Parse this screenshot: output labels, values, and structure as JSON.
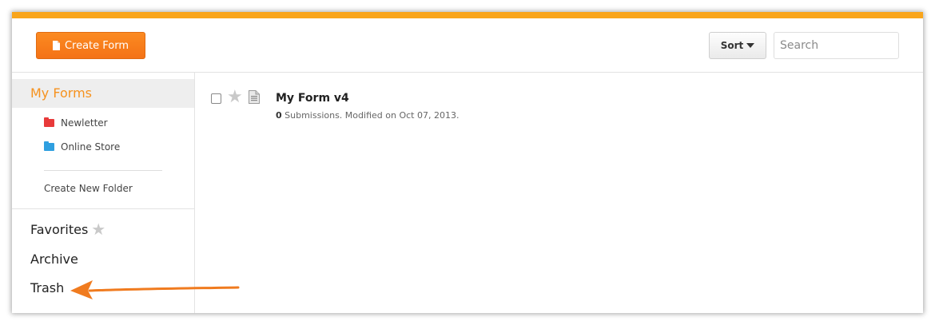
{
  "toolbar": {
    "create_label": "Create Form",
    "sort_label": "Sort",
    "search_placeholder": "Search"
  },
  "sidebar": {
    "my_forms": "My Forms",
    "folders": [
      {
        "label": "Newletter",
        "color": "#e83a3a"
      },
      {
        "label": "Online Store",
        "color": "#2f9fe0"
      }
    ],
    "create_folder": "Create New Folder",
    "favorites": "Favorites",
    "archive": "Archive",
    "trash": "Trash"
  },
  "forms": [
    {
      "title": "My Form v4",
      "submissions": "0",
      "meta": " Submissions. Modified on Oct 07, 2013."
    }
  ],
  "colors": {
    "accent": "#f9a51b",
    "button": "#f47216",
    "arrow": "#f07b1f"
  }
}
